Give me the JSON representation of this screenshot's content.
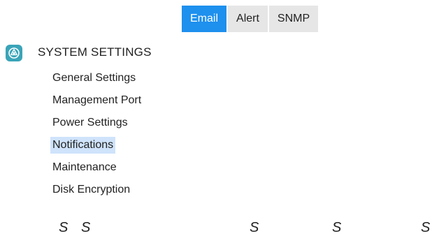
{
  "tabs": [
    {
      "label": "Email",
      "active": true
    },
    {
      "label": "Alert",
      "active": false
    },
    {
      "label": "SNMP",
      "active": false
    }
  ],
  "section": {
    "title": "SYSTEM SETTINGS",
    "icon": "system-settings-icon",
    "icon_color": "#3aa4b8"
  },
  "menu": {
    "items": [
      {
        "label": "General Settings"
      },
      {
        "label": "Management Port"
      },
      {
        "label": "Power Settings"
      },
      {
        "label": "Notifications",
        "selected": true
      },
      {
        "label": "Maintenance"
      },
      {
        "label": "Disk Encryption"
      }
    ]
  },
  "bottom_row": {
    "glyphs": [
      "S",
      "S",
      "S",
      "S",
      "S"
    ]
  },
  "colors": {
    "accent": "#1e90ee",
    "selected_bg": "#cfe3fb",
    "tab_bg": "#e6e6e6"
  }
}
